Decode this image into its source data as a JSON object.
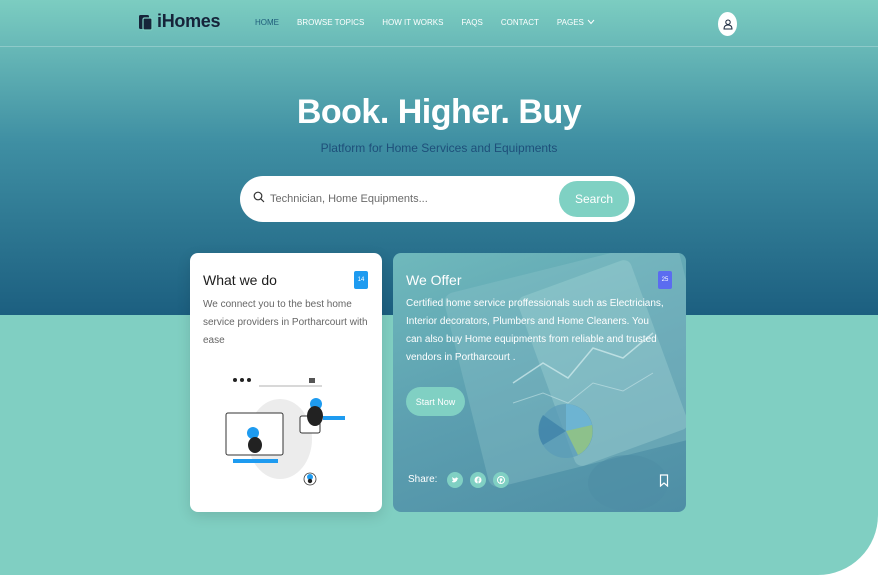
{
  "brand": {
    "name": "iHomes"
  },
  "nav": {
    "items": [
      {
        "label": "HOME",
        "active": true
      },
      {
        "label": "BROWSE TOPICS",
        "active": false
      },
      {
        "label": "HOW IT WORKS",
        "active": false
      },
      {
        "label": "FAQS",
        "active": false
      },
      {
        "label": "CONTACT",
        "active": false
      },
      {
        "label": "PAGES",
        "active": false
      }
    ],
    "user_icon": "user-icon"
  },
  "hero": {
    "title": "Book. Higher. Buy",
    "subtitle": "Platform for Home Services and Equipments"
  },
  "search": {
    "placeholder": "Technician, Home Equipments...",
    "value": "",
    "button_label": "Search"
  },
  "cards": {
    "what_we_do": {
      "title": "What we do",
      "badge": "14",
      "text": "We connect you to the best home service providers in Portharcourt with ease"
    },
    "we_offer": {
      "title": "We Offer",
      "badge": "25",
      "text": "Certified home service proffessionals such as Electricians, Interior decorators, Plumbers and Home Cleaners. You can also buy Home equipments from reliable and trusted vendors in Portharcourt .",
      "button_label": "Start Now",
      "share_label": "Share:"
    }
  },
  "colors": {
    "accent": "#80d0c3",
    "badge_blue": "#1e9bf0",
    "badge_purple": "#5b6cf0",
    "dark_text": "#16243a"
  }
}
